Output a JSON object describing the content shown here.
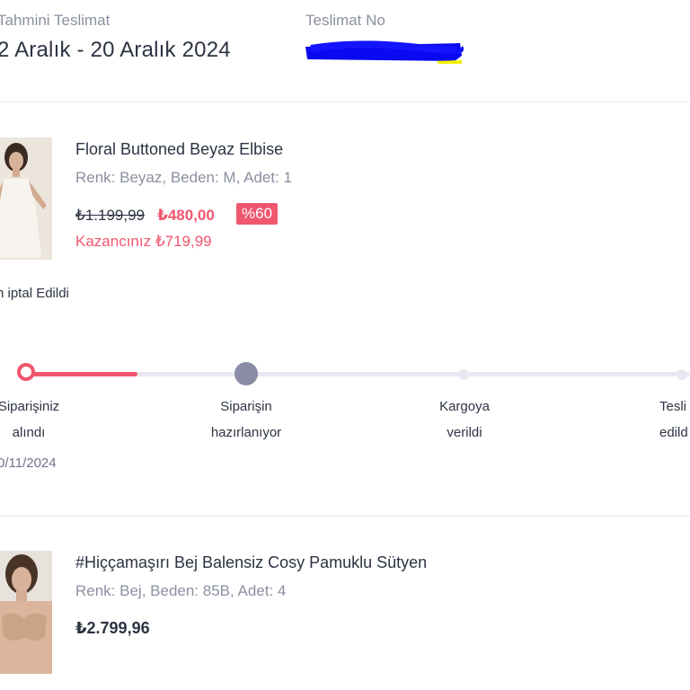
{
  "header": {
    "estimated_label": "Tahmini Teslimat",
    "estimated_value": "2 Aralık - 20 Aralık 2024",
    "delivery_no_label": "Teslimat No"
  },
  "item1": {
    "name": "Floral Buttoned Beyaz Elbise",
    "meta": "Renk: Beyaz, Beden: M, Adet: 1",
    "old_price": "₺1.199,99",
    "new_price": "₺480,00",
    "discount_badge": "%60",
    "savings": "Kazancınız ₺719,99",
    "status_note": "n iptal Edildi"
  },
  "progress": {
    "value_fraction": 0.27,
    "colors": {
      "active": "#f0566e",
      "inactive": "#e8e8f2",
      "current": "#8b8ca6"
    },
    "steps": [
      {
        "line1": "Siparişiniz",
        "line2": "alındı",
        "date": "0/11/2024"
      },
      {
        "line1": "Siparişin",
        "line2": "hazırlanıyor"
      },
      {
        "line1": "Kargoya",
        "line2": "verildi"
      },
      {
        "line1": "Tesli",
        "line2": "edild"
      }
    ]
  },
  "item2": {
    "name": "#Hiççamaşırı Bej Balensiz Cosy Pamuklu Sütyen",
    "meta": "Renk: Bej, Beden: 85B, Adet: 4",
    "price": "₺2.799,96"
  }
}
